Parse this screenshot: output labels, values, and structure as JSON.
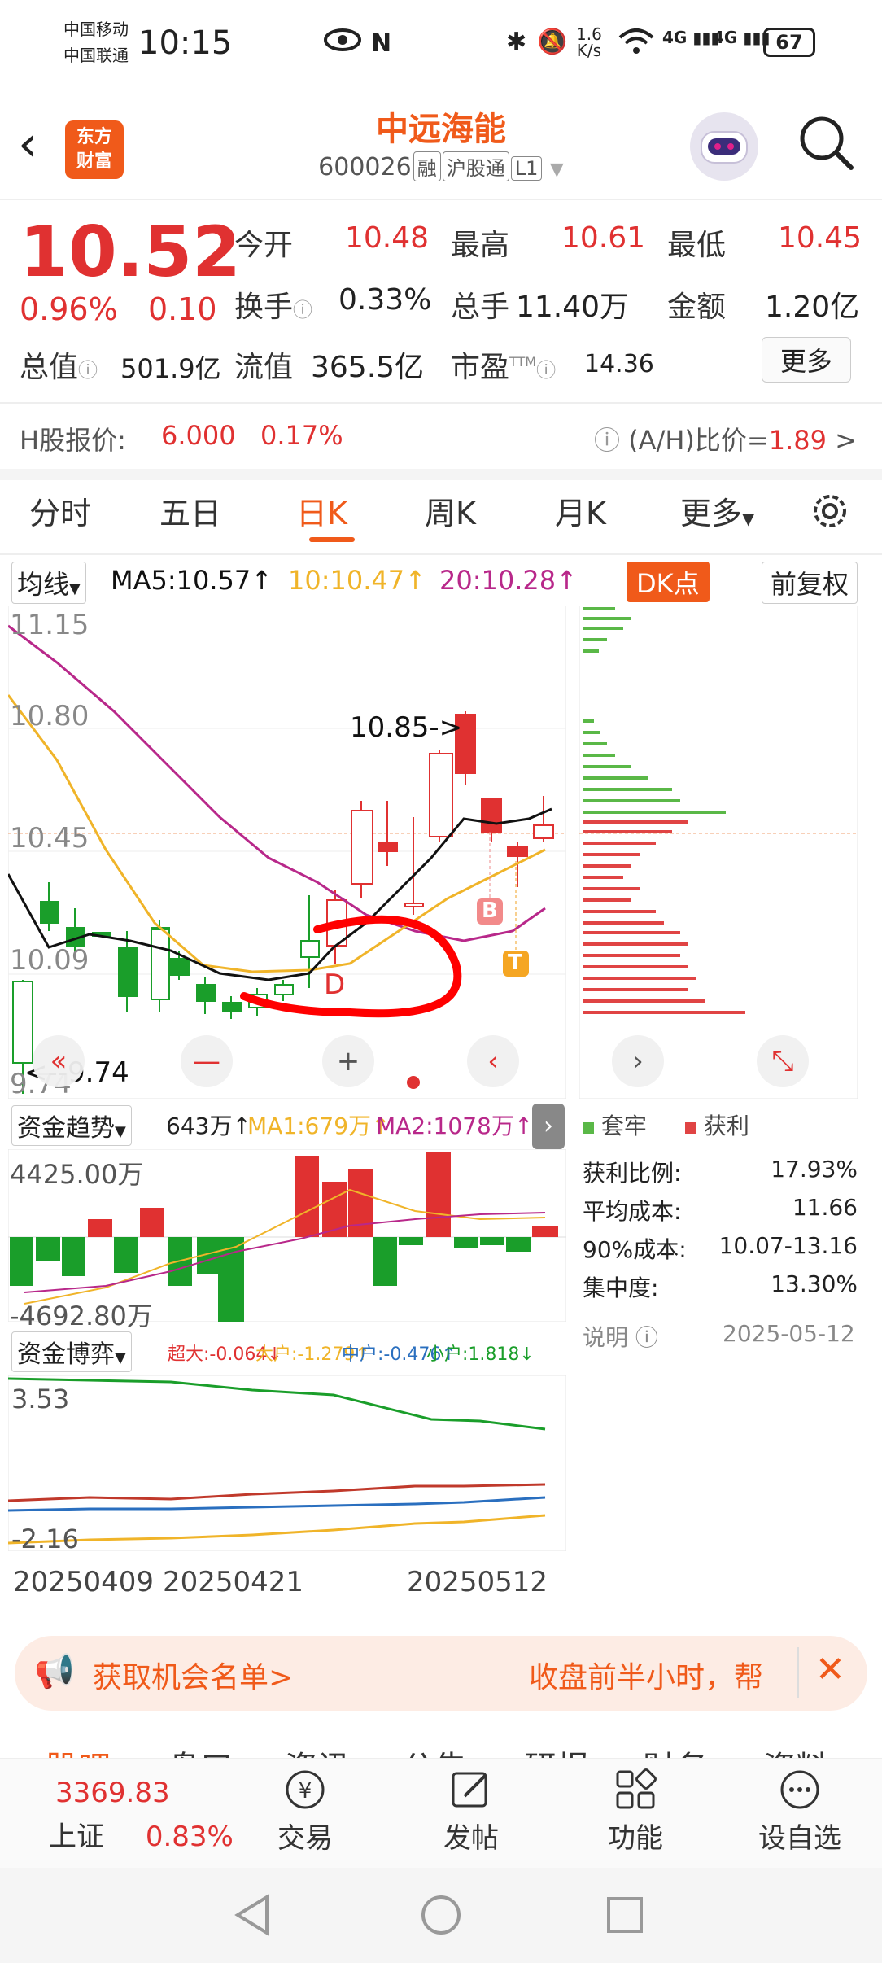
{
  "status": {
    "carrier1": "中国移动",
    "carrier2": "中国联通",
    "time": "10:15",
    "speed_value": "1.6",
    "speed_unit": "K/s",
    "net1": "4G",
    "net2": "4G",
    "battery": "67"
  },
  "header": {
    "logo_line1": "东方",
    "logo_line2": "财富",
    "stock_name": "中远海能",
    "code": "600026",
    "tag1": "融",
    "tag2": "沪股通",
    "tag3": "L1"
  },
  "quote": {
    "price": "10.52",
    "change_pct": "0.96%",
    "change": "0.10",
    "open_label": "今开",
    "open": "10.48",
    "high_label": "最高",
    "high": "10.61",
    "low_label": "最低",
    "low": "10.45",
    "turnover_label": "换手",
    "turnover": "0.33%",
    "volume_label": "总手",
    "volume": "11.40万",
    "amount_label": "金额",
    "amount": "1.20亿",
    "mktcap_label": "总值",
    "mktcap": "501.9亿",
    "float_label": "流值",
    "float": "365.5亿",
    "pe_label": "市盈",
    "pe_sup": "TTM",
    "pe": "14.36",
    "more": "更多"
  },
  "hshare": {
    "label": "H股报价:",
    "price": "6.000",
    "pct": "0.17%",
    "ratio_label": "(A/H)比价=",
    "ratio": "1.89",
    "arrow": ">"
  },
  "tabs": [
    "分时",
    "五日",
    "日K",
    "周K",
    "月K",
    "更多"
  ],
  "active_tab": "日K",
  "ma_bar": {
    "selector": "均线",
    "ma5": "MA5:10.57↑",
    "ma10": "10:10.47↑",
    "ma20": "20:10.28↑",
    "dk_btn": "DK点",
    "adjust_btn": "前复权"
  },
  "kchart": {
    "y_labels": [
      "11.15",
      "10.80",
      "10.45",
      "10.09",
      "9.74"
    ],
    "high_marker": "10.85->",
    "low_marker": "<--9.74",
    "marker_B": "B",
    "marker_T": "T",
    "marker_D": "D"
  },
  "chip": {
    "legend_trapped": "套牢",
    "legend_profit": "获利",
    "rows": [
      {
        "label": "获利比例:",
        "value": "17.93%"
      },
      {
        "label": "平均成本:",
        "value": "11.66"
      },
      {
        "label": "90%成本:",
        "value": "10.07-13.16"
      },
      {
        "label": "集中度:",
        "value": "13.30%"
      }
    ],
    "note": "说明",
    "date": "2025-05-12"
  },
  "fund_trend": {
    "selector": "资金趋势",
    "value": "643万↑",
    "ma1": "MA1:679万↑",
    "ma2": "MA2:1078万↑",
    "top": "4425.00万",
    "bottom": "-4692.80万"
  },
  "fund_game": {
    "selector": "资金博弈",
    "super": "超大:-0.064↓",
    "big": "大户:-1.279↑",
    "mid": "中户:-0.476↑",
    "small": "小户:1.818↓",
    "top": "3.53",
    "bottom": "-2.16"
  },
  "dates": [
    "20250409",
    "20250421",
    "20250512"
  ],
  "banner": {
    "text": "获取机会名单>",
    "right": "收盘前半小时，帮"
  },
  "subtabs_partial": [
    "股吧",
    "盘口",
    "资讯",
    "公告",
    "研报",
    "财务",
    "资料"
  ],
  "bottom_nav": {
    "index_value": "3369.83",
    "index_name": "上证",
    "index_pct": "0.83%",
    "trade": "交易",
    "post": "发帖",
    "func": "功能",
    "watch": "设自选"
  },
  "colors": {
    "brand": "#f05a1a",
    "up": "#e03131",
    "down": "#1a9e2a",
    "ma5": "#111111",
    "ma10": "#f0b429",
    "ma20": "#b8288a"
  }
}
